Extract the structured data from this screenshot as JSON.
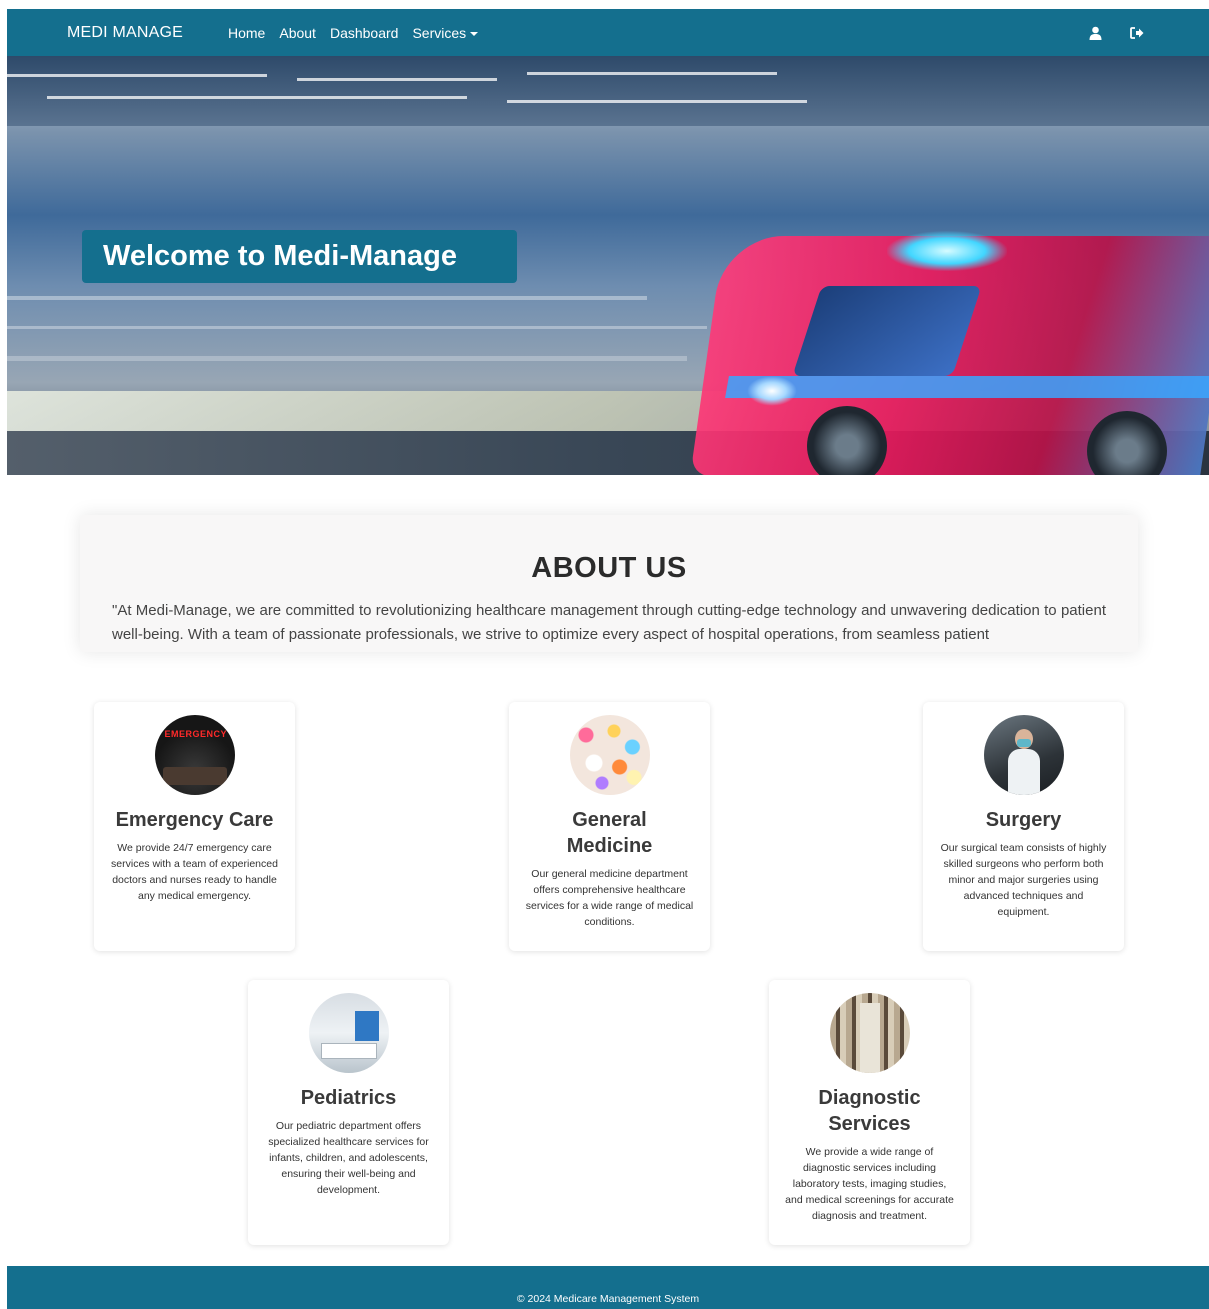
{
  "navbar": {
    "brand": "MEDI MANAGE",
    "links": [
      {
        "label": "Home"
      },
      {
        "label": "About"
      },
      {
        "label": "Dashboard"
      },
      {
        "label": "Services"
      }
    ],
    "icons": [
      "user-icon",
      "logout-icon"
    ],
    "background": "#146f8e"
  },
  "hero": {
    "title": "Welcome to Medi-Manage",
    "image": "ambulance-motion-blur"
  },
  "about": {
    "title": "ABOUT US",
    "text": "\"At Medi-Manage, we are committed to revolutionizing healthcare management through cutting-edge technology and unwavering dedication to patient well-being. With a team of passionate professionals, we strive to optimize every aspect of hospital operations, from seamless patient"
  },
  "services": [
    {
      "title": "Emergency Care",
      "text": "We provide 24/7 emergency care services with a team of experienced doctors and nurses ready to handle any medical emergency.",
      "image": "emergency-room-image",
      "image_label": "EMERGENCY"
    },
    {
      "title": "General Medicine",
      "text": "Our general medicine department offers comprehensive healthcare services for a wide range of medical conditions.",
      "image": "pills-image"
    },
    {
      "title": "Surgery",
      "text": "Our surgical team consists of highly skilled surgeons who perform both minor and major surgeries using advanced techniques and equipment.",
      "image": "surgeon-image"
    },
    {
      "title": "Pediatrics",
      "text": "Our pediatric department offers specialized healthcare services for infants, children, and adolescents, ensuring their well-being and development.",
      "image": "pediatric-room-image"
    },
    {
      "title": "Diagnostic Services",
      "text": "We provide a wide range of diagnostic services including laboratory tests, imaging studies, and medical screenings for accurate diagnosis and treatment.",
      "image": "lab-image"
    }
  ],
  "footer": {
    "text": "© 2024 Medicare Management System"
  }
}
